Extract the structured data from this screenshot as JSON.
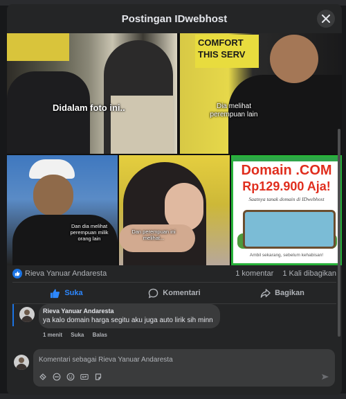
{
  "modal": {
    "title": "Postingan IDwebhost"
  },
  "photos": [
    {
      "caption": "Didalam foto ini.."
    },
    {
      "caption": "Dia melihat perempuan lain",
      "sign": "COMFORT THIS SERV"
    },
    {
      "caption": "Dan dia melihat perempuan milik orang lain"
    },
    {
      "caption": "Dan perempuan ini melihat..."
    },
    {
      "banner_title": "Domain .COM",
      "banner_price": "Rp129.900 Aja!",
      "banner_tagline": "Saatnya tanak domain di IDwebhost",
      "banner_footer": "Ambil sekarang, sebelum kehabisan!"
    }
  ],
  "reactions": {
    "liker": "Rieva Yanuar Andaresta",
    "comments_count": "1 komentar",
    "shares_count": "1 Kali dibagikan"
  },
  "actions": {
    "like": "Suka",
    "comment": "Komentari",
    "share": "Bagikan"
  },
  "comment": {
    "author": "Rieva Yanuar Andaresta",
    "text": "ya kalo domain harga segitu aku juga auto lirik sih minn",
    "time": "1 menit",
    "like": "Suka",
    "reply": "Balas"
  },
  "composer": {
    "placeholder": "Komentari sebagai Rieva Yanuar Andaresta"
  },
  "colors": {
    "accent": "#1b74e4",
    "background": "#242526",
    "bubble": "#3a3b3c"
  },
  "icons": [
    "close-icon",
    "like-icon",
    "comment-icon",
    "share-icon",
    "sticker-icon",
    "gif-icon",
    "emoji-icon",
    "camera-icon",
    "avatar-sticker-icon",
    "send-icon"
  ]
}
